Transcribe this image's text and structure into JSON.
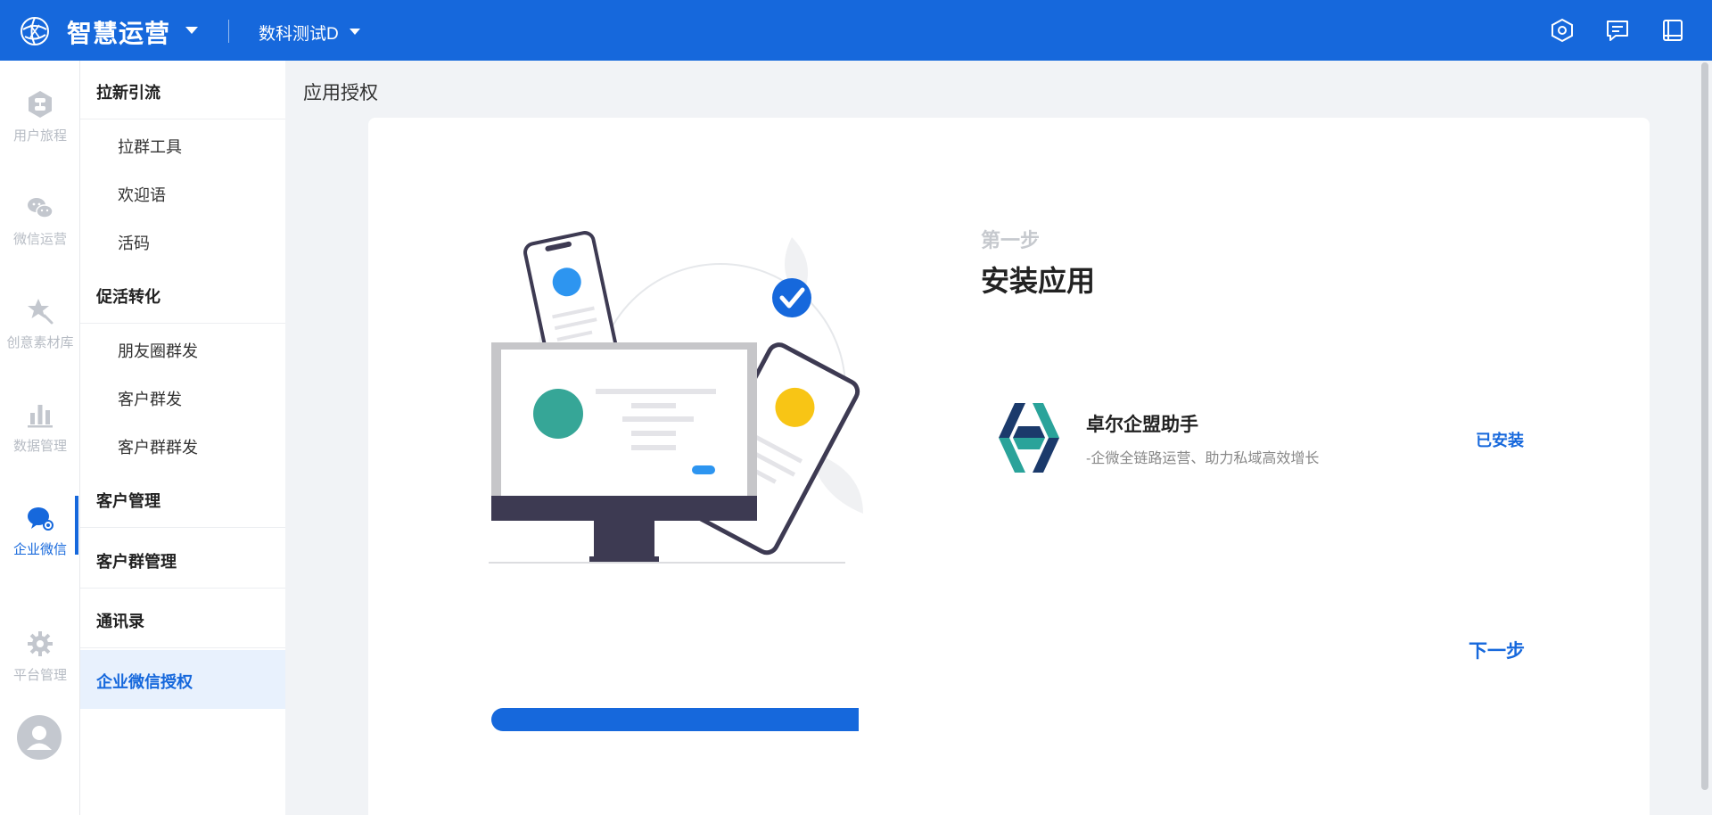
{
  "header": {
    "logo_icon": "brain-globe-icon",
    "app_title": "智慧运营",
    "account": "数科测试D",
    "icons": [
      "hexagon-settings-icon",
      "message-icon",
      "book-icon"
    ]
  },
  "rail": {
    "items": [
      {
        "label": "用户旅程",
        "icon": "user-journey-icon"
      },
      {
        "label": "微信运营",
        "icon": "wechat-icon"
      },
      {
        "label": "创意素材库",
        "icon": "creative-star-icon"
      },
      {
        "label": "数据管理",
        "icon": "bar-chart-icon"
      },
      {
        "label": "企业微信",
        "icon": "work-wechat-icon",
        "active": true
      },
      {
        "label": "平台管理",
        "icon": "gear-icon"
      }
    ],
    "avatar_icon": "user-avatar-icon"
  },
  "submenu": {
    "groups": [
      {
        "title": "拉新引流",
        "items": [
          "拉群工具",
          "欢迎语",
          "活码"
        ]
      },
      {
        "title": "促活转化",
        "items": [
          "朋友圈群发",
          "客户群发",
          "客户群群发"
        ]
      },
      {
        "title": "客户管理",
        "items": []
      },
      {
        "title": "客户群管理",
        "items": []
      },
      {
        "title": "通讯录",
        "items": []
      },
      {
        "title": "企业微信授权",
        "items": [],
        "active": true
      }
    ]
  },
  "main": {
    "page_title": "应用授权",
    "step_label": "第一步",
    "step_title": "安装应用",
    "app": {
      "name": "卓尔企盟助手",
      "description": "-企微全链路运营、助力私域高效增长",
      "status": "已安装"
    },
    "next_button": "下一步",
    "progress_fraction": 0.333
  },
  "colors": {
    "primary": "#1668dc",
    "active_bg": "#e8f1fd",
    "muted": "#b7bcc4"
  }
}
